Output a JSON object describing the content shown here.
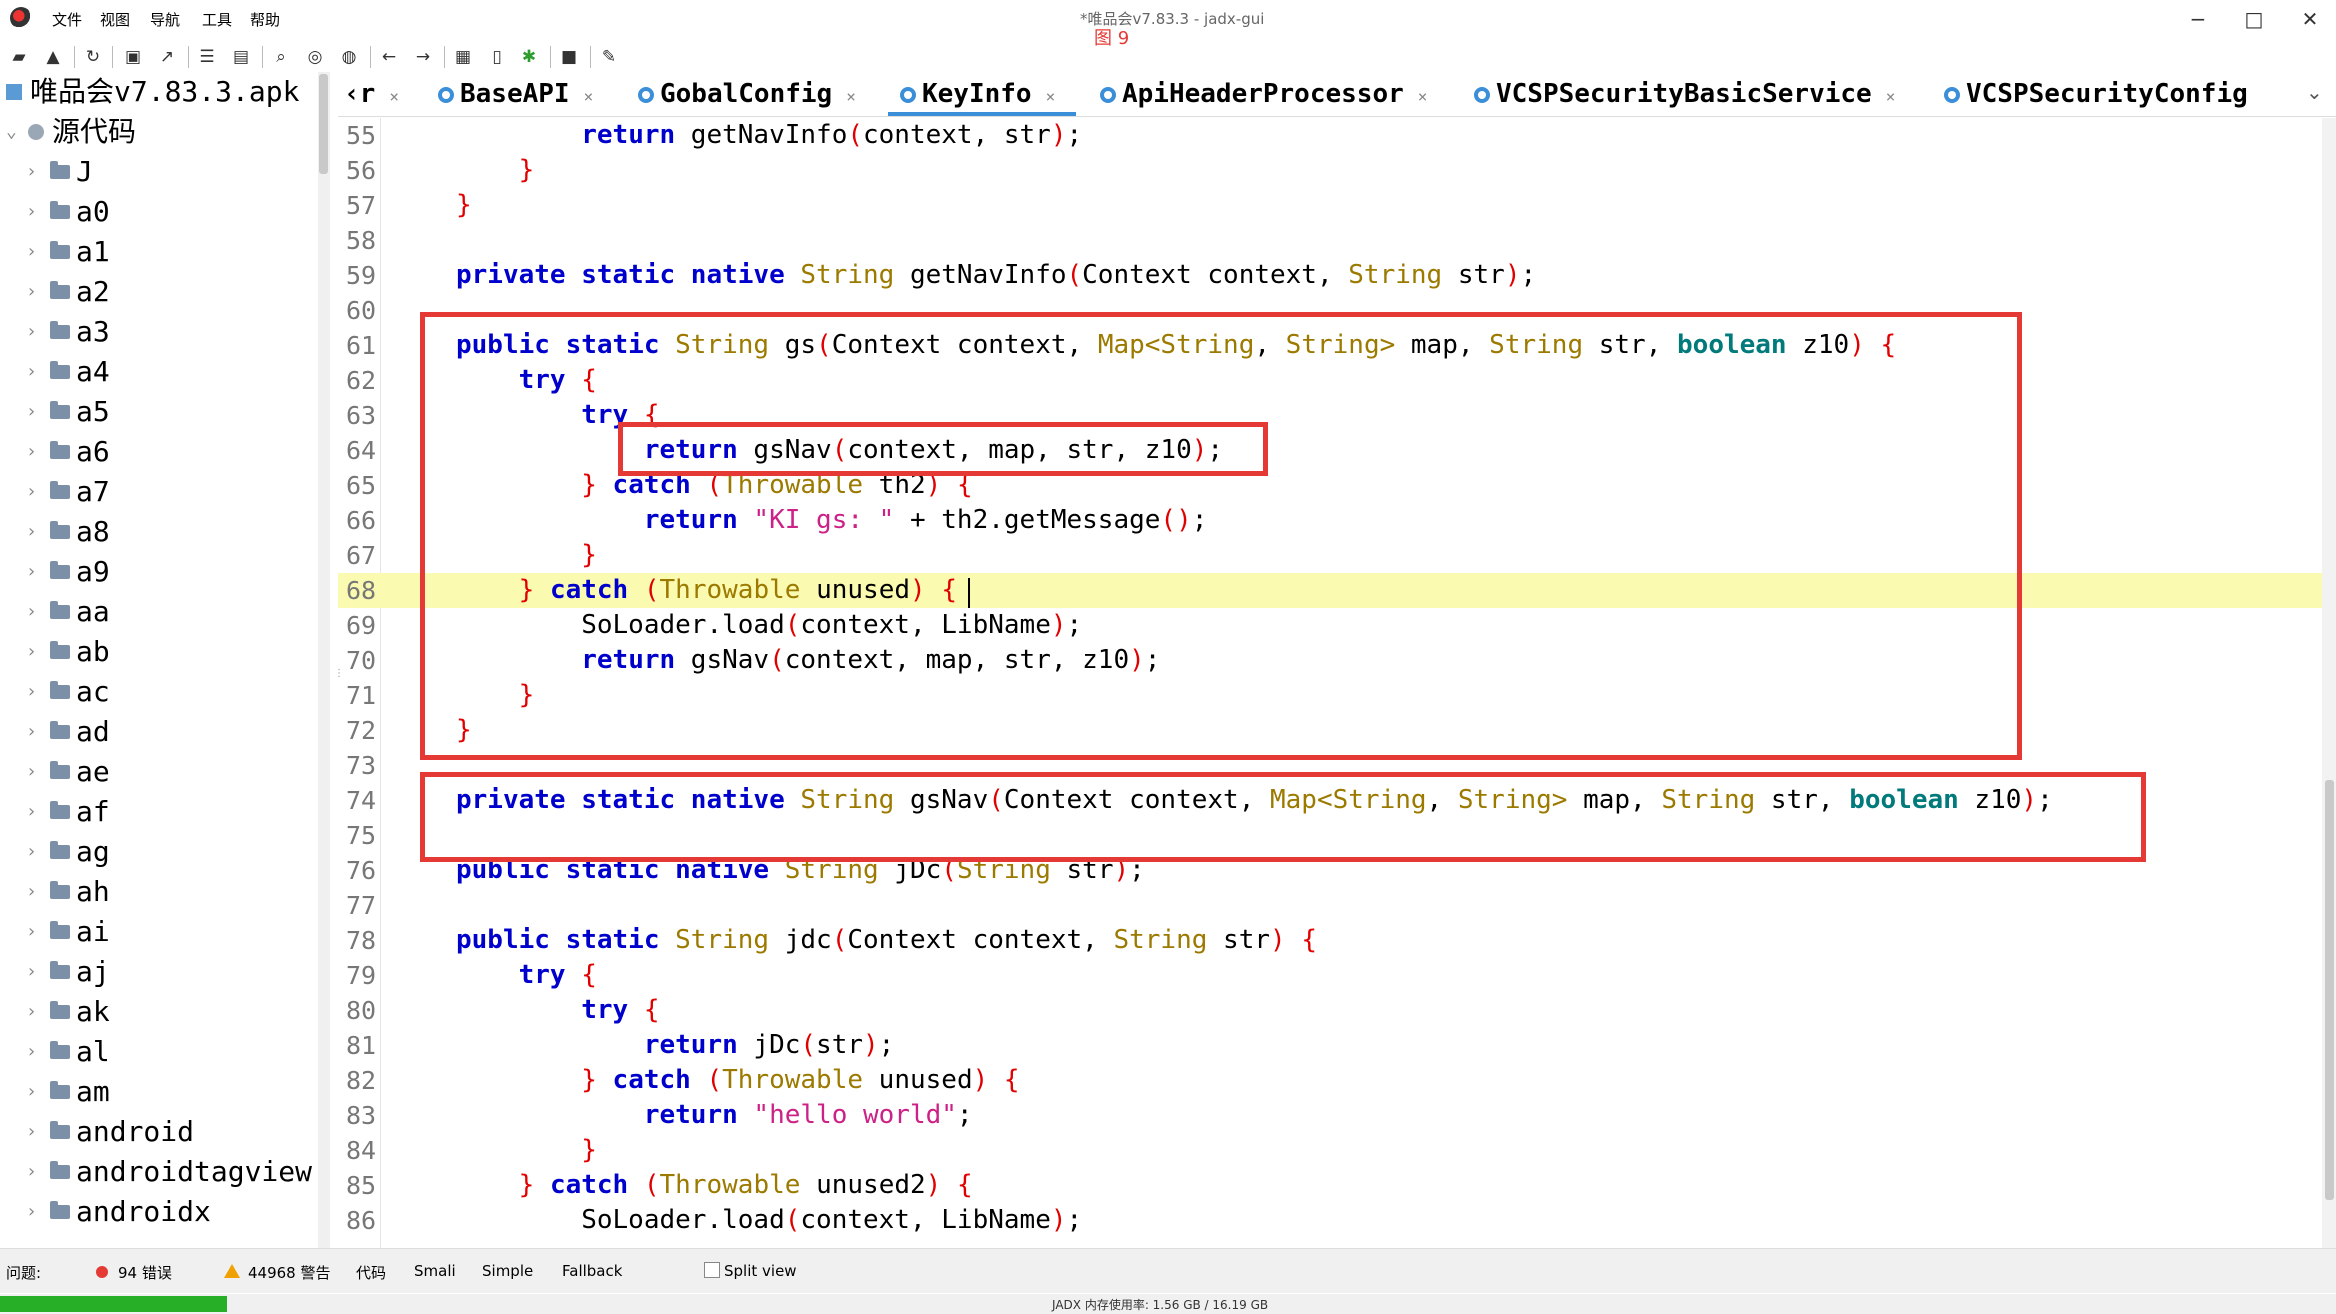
{
  "window": {
    "title": "*唯品会v7.83.3 - jadx-gui",
    "figure_label": "图 9",
    "menu": [
      "文件",
      "视图",
      "导航",
      "工具",
      "帮助"
    ]
  },
  "tree": {
    "root": "唯品会v7.83.3.apk",
    "source": "源代码",
    "packages": [
      "J",
      "a0",
      "a1",
      "a2",
      "a3",
      "a4",
      "a5",
      "a6",
      "a7",
      "a8",
      "a9",
      "aa",
      "ab",
      "ac",
      "ad",
      "ae",
      "af",
      "ag",
      "ah",
      "ai",
      "aj",
      "ak",
      "al",
      "am",
      "android",
      "androidtagview",
      "androidx"
    ]
  },
  "tabs": [
    {
      "label": "‹r"
    },
    {
      "label": "BaseAPI"
    },
    {
      "label": "GobalConfig"
    },
    {
      "label": "KeyInfo",
      "active": true
    },
    {
      "label": "ApiHeaderProcessor"
    },
    {
      "label": "VCSPSecurityBasicService"
    },
    {
      "label": "VCSPSecurityConfig"
    }
  ],
  "code": {
    "line_numbers": [
      "55",
      "56",
      "57",
      "58",
      "59",
      "60",
      "61",
      "62",
      "63",
      "64",
      "65",
      "66",
      "67",
      "68",
      "69",
      "70",
      "71",
      "72",
      "73",
      "74",
      "75",
      "76",
      "77",
      "78",
      "79",
      "80",
      "81",
      "82",
      "83",
      "84",
      "85",
      "86"
    ],
    "highlighted_line": "68"
  },
  "bottom": {
    "problems_label": "问题:",
    "errors": "94 错误",
    "warnings": "44968 警告",
    "view_tabs": [
      "代码",
      "Smali",
      "Simple",
      "Fallback"
    ],
    "split_view": "Split view",
    "memory": "JADX 内存使用率: 1.56 GB / 16.19 GB",
    "progress": 0.097
  },
  "colors": {
    "keyword": "#0000cc",
    "type": "#9c7a00",
    "brace": "#e00000",
    "string": "#cc2288",
    "highlight": "#fafab0",
    "annotation": "#e53935",
    "accent": "#3b8ed8"
  }
}
